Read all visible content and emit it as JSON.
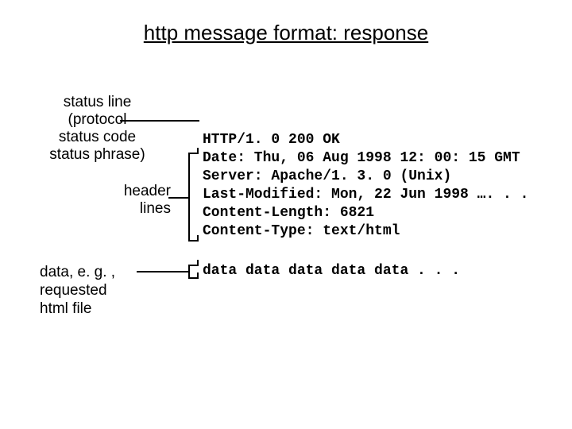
{
  "title": "http message format: response",
  "labels": {
    "status": "status line\n(protocol\nstatus code\nstatus phrase)",
    "header": "header\nlines",
    "data": "data, e. g. ,\nrequested\nhtml file"
  },
  "message": {
    "status_line": "HTTP/1. 0 200 OK",
    "headers": "Date: Thu, 06 Aug 1998 12: 00: 15 GMT\nServer: Apache/1. 3. 0 (Unix)\nLast-Modified: Mon, 22 Jun 1998 …. . .\nContent-Length: 6821\nContent-Type: text/html",
    "body": "data data data data data . . ."
  }
}
